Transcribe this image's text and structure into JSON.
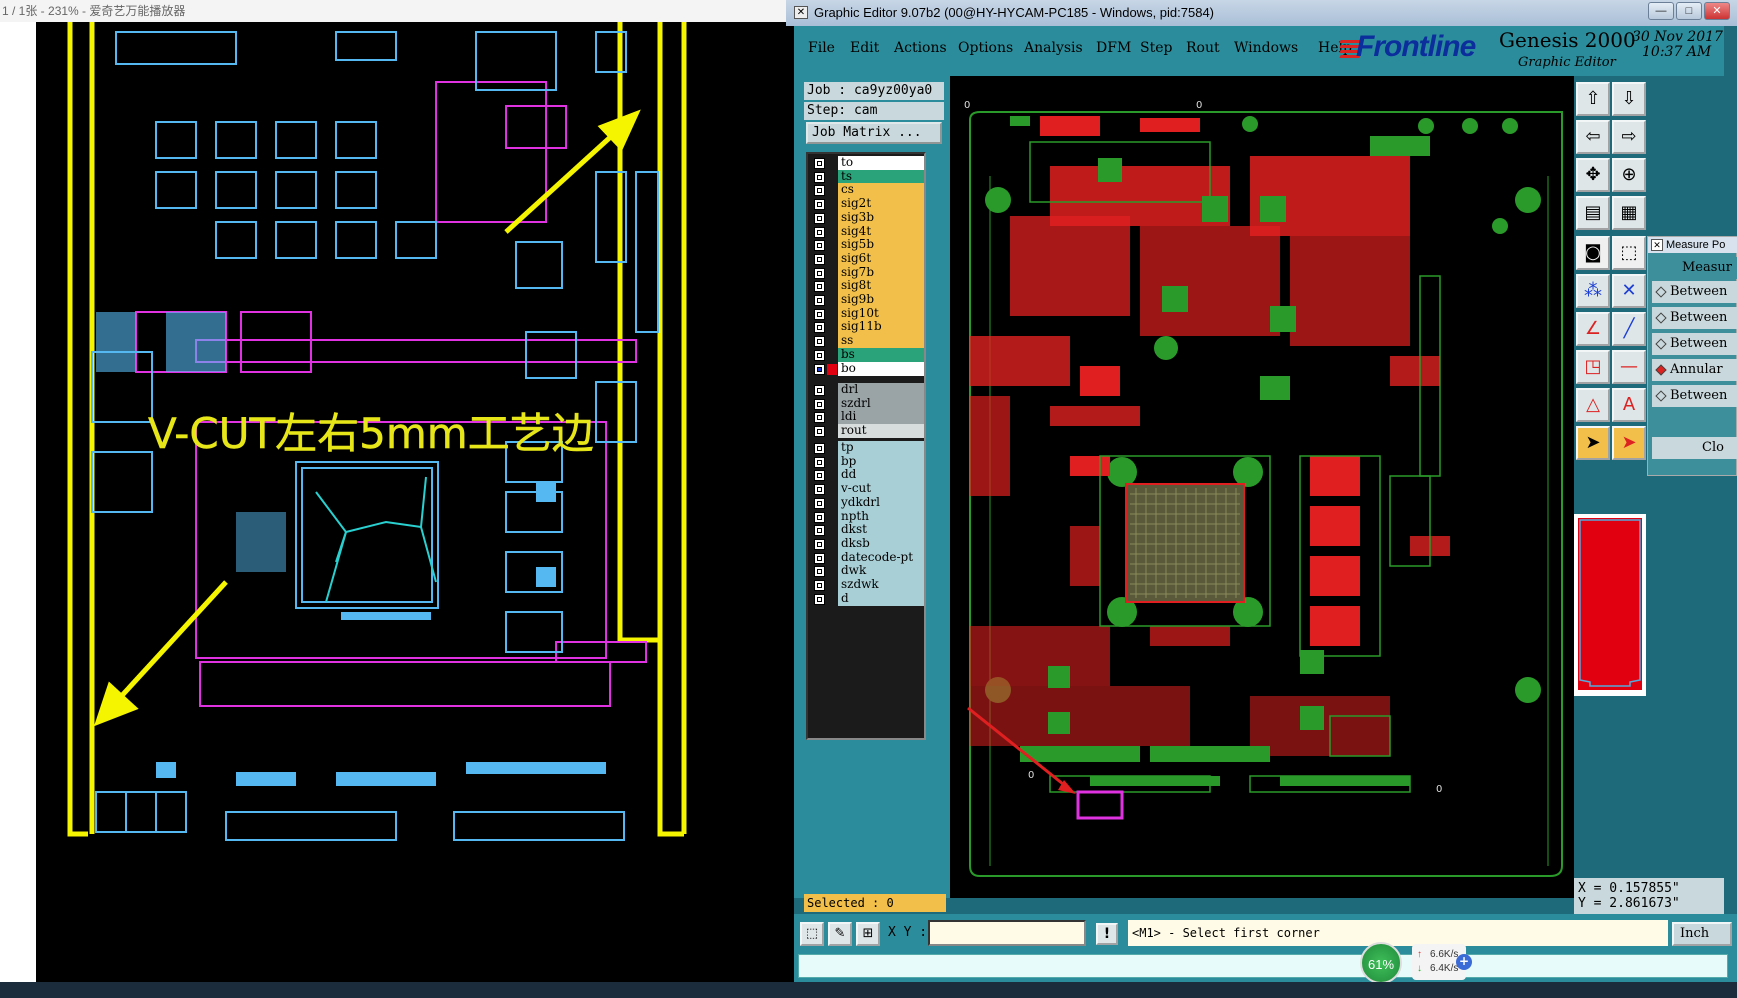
{
  "viewer": {
    "title": "1 / 1张 - 231% - 爱奇艺万能播放器",
    "annotation": "V-CUT左右5mm工艺边"
  },
  "genesis": {
    "window_title": "Graphic Editor 9.07b2 (00@HY-HYCAM-PC185 - Windows, pid:7584)",
    "window_buttons": [
      "—",
      "□",
      "✕"
    ],
    "menu": [
      "File",
      "Edit",
      "Actions",
      "Options",
      "Analysis",
      "DFM",
      "Step",
      "Rout",
      "Windows",
      "Help"
    ],
    "brand": {
      "frontline": "Frontline",
      "product": "Genesis 2000",
      "subtitle": "Graphic Editor",
      "date": "30 Nov 2017",
      "time": "10:37 AM"
    },
    "job_line": "Job : ca9yz00ya0",
    "step_line": "Step: cam",
    "job_matrix_button": "Job Matrix ...",
    "layers_board": [
      {
        "name": "to",
        "color": "#ffffff",
        "active": true
      },
      {
        "name": "ts",
        "color": "#2aa37a"
      },
      {
        "name": "cs",
        "color": "#f2c04a"
      },
      {
        "name": "sig2t",
        "color": "#f2c04a"
      },
      {
        "name": "sig3b",
        "color": "#f2c04a"
      },
      {
        "name": "sig4t",
        "color": "#f2c04a"
      },
      {
        "name": "sig5b",
        "color": "#f2c04a"
      },
      {
        "name": "sig6t",
        "color": "#f2c04a"
      },
      {
        "name": "sig7b",
        "color": "#f2c04a"
      },
      {
        "name": "sig8t",
        "color": "#f2c04a"
      },
      {
        "name": "sig9b",
        "color": "#f2c04a"
      },
      {
        "name": "sig10t",
        "color": "#f2c04a"
      },
      {
        "name": "sig11b",
        "color": "#f2c04a"
      },
      {
        "name": "ss",
        "color": "#f2c04a"
      },
      {
        "name": "bs",
        "color": "#2aa37a"
      },
      {
        "name": "bo",
        "color": "#ffffff",
        "active": true
      }
    ],
    "layers_drill": [
      {
        "name": "drl",
        "color": "#9aa3a6"
      },
      {
        "name": "szdrl",
        "color": "#9aa3a6"
      },
      {
        "name": "ldi",
        "color": "#9aa3a6"
      },
      {
        "name": "rout",
        "color": "#d7dcdc"
      }
    ],
    "layers_misc": [
      {
        "name": "tp",
        "color": "#a9cfd6"
      },
      {
        "name": "bp",
        "color": "#a9cfd6"
      },
      {
        "name": "dd",
        "color": "#a9cfd6"
      },
      {
        "name": "v-cut",
        "color": "#a9cfd6"
      },
      {
        "name": "ydkdrl",
        "color": "#a9cfd6"
      },
      {
        "name": "npth",
        "color": "#a9cfd6"
      },
      {
        "name": "dkst",
        "color": "#a9cfd6"
      },
      {
        "name": "dksb",
        "color": "#a9cfd6"
      },
      {
        "name": "datecode-pt",
        "color": "#a9cfd6"
      },
      {
        "name": "dwk",
        "color": "#a9cfd6"
      },
      {
        "name": "szdwk",
        "color": "#a9cfd6"
      },
      {
        "name": "d",
        "color": "#a9cfd6"
      }
    ],
    "selected": "Selected : 0",
    "origin_labels": [
      "0",
      "0",
      "0",
      "0"
    ],
    "measure": {
      "title": "Measure Po",
      "header": "Measur",
      "items": [
        "Between",
        "Between",
        "Between",
        "Annular",
        "Between"
      ],
      "selected_index": 3,
      "close": "Clo"
    },
    "coords": {
      "x": "X = 0.157855\"",
      "y": "Y = 2.861673\""
    },
    "xy_label": "X Y :",
    "xy_value": "",
    "prompt": "<M1> - Select first corner",
    "unit": "Inch",
    "net": {
      "percent": "61%",
      "up": "6.6K/s",
      "down": "6.4K/s"
    },
    "colors": {
      "accent": "#2b8d9b",
      "pad_green": "#2a9a2a",
      "trace_red": "#e02020",
      "highlight": "#f2c04a"
    }
  }
}
